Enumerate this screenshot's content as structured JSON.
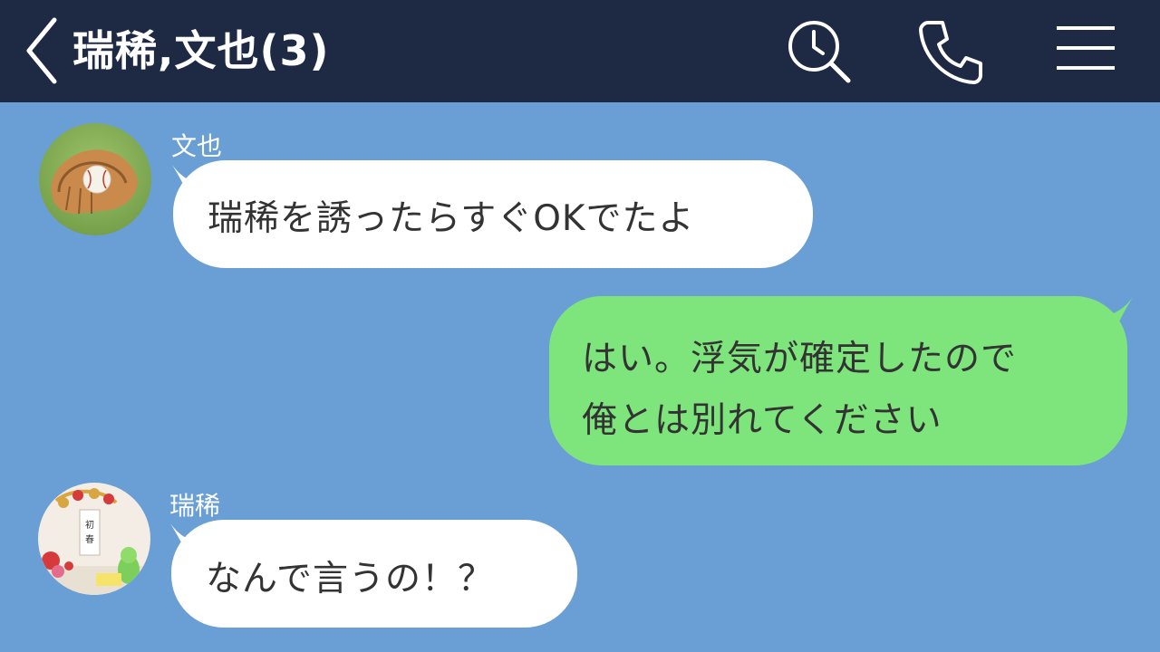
{
  "header": {
    "title": "瑞稀,文也(3)",
    "icons": {
      "back": "chevron-left-icon",
      "search": "clock-search-icon",
      "call": "phone-icon",
      "menu": "hamburger-menu-icon"
    },
    "colors": {
      "background": "#1e2a43",
      "icon": "#ffffff"
    }
  },
  "chat": {
    "background_color": "#6a9fd6",
    "messages": [
      {
        "direction": "incoming",
        "sender": "文也",
        "avatar": "baseball-glove-avatar",
        "text": "瑞稀を誘ったらすぐOKでたよ"
      },
      {
        "direction": "outgoing",
        "lines": [
          "はい。浮気が確定したので",
          "俺とは別れてください"
        ]
      },
      {
        "direction": "incoming",
        "sender": "瑞稀",
        "avatar": "new-year-decoration-avatar",
        "text": "なんで言うの！？"
      }
    ],
    "colors": {
      "incoming_bubble": "#ffffff",
      "outgoing_bubble": "#7ee57c",
      "text": "#333333"
    }
  }
}
